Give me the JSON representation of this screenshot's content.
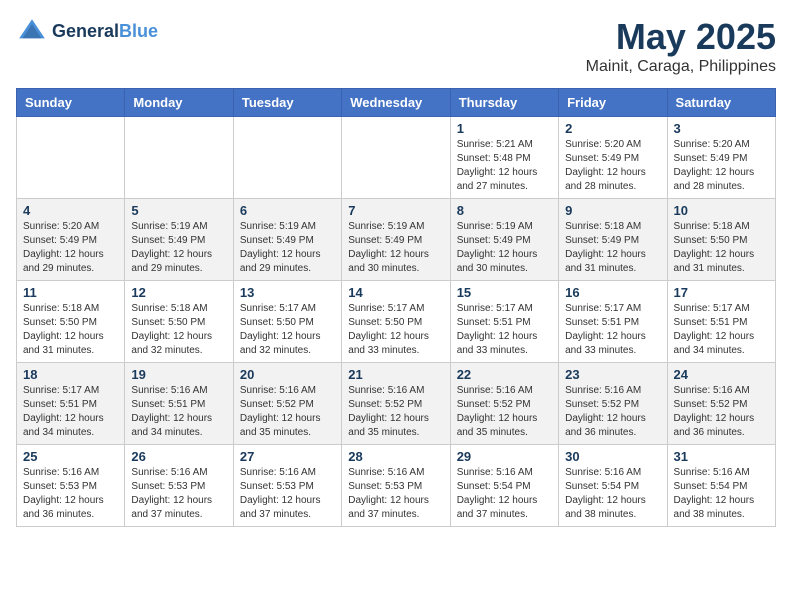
{
  "header": {
    "logo_line1": "General",
    "logo_line2": "Blue",
    "title": "May 2025",
    "subtitle": "Mainit, Caraga, Philippines"
  },
  "weekdays": [
    "Sunday",
    "Monday",
    "Tuesday",
    "Wednesday",
    "Thursday",
    "Friday",
    "Saturday"
  ],
  "weeks": [
    [
      {
        "day": "",
        "info": ""
      },
      {
        "day": "",
        "info": ""
      },
      {
        "day": "",
        "info": ""
      },
      {
        "day": "",
        "info": ""
      },
      {
        "day": "1",
        "info": "Sunrise: 5:21 AM\nSunset: 5:48 PM\nDaylight: 12 hours\nand 27 minutes."
      },
      {
        "day": "2",
        "info": "Sunrise: 5:20 AM\nSunset: 5:49 PM\nDaylight: 12 hours\nand 28 minutes."
      },
      {
        "day": "3",
        "info": "Sunrise: 5:20 AM\nSunset: 5:49 PM\nDaylight: 12 hours\nand 28 minutes."
      }
    ],
    [
      {
        "day": "4",
        "info": "Sunrise: 5:20 AM\nSunset: 5:49 PM\nDaylight: 12 hours\nand 29 minutes."
      },
      {
        "day": "5",
        "info": "Sunrise: 5:19 AM\nSunset: 5:49 PM\nDaylight: 12 hours\nand 29 minutes."
      },
      {
        "day": "6",
        "info": "Sunrise: 5:19 AM\nSunset: 5:49 PM\nDaylight: 12 hours\nand 29 minutes."
      },
      {
        "day": "7",
        "info": "Sunrise: 5:19 AM\nSunset: 5:49 PM\nDaylight: 12 hours\nand 30 minutes."
      },
      {
        "day": "8",
        "info": "Sunrise: 5:19 AM\nSunset: 5:49 PM\nDaylight: 12 hours\nand 30 minutes."
      },
      {
        "day": "9",
        "info": "Sunrise: 5:18 AM\nSunset: 5:49 PM\nDaylight: 12 hours\nand 31 minutes."
      },
      {
        "day": "10",
        "info": "Sunrise: 5:18 AM\nSunset: 5:50 PM\nDaylight: 12 hours\nand 31 minutes."
      }
    ],
    [
      {
        "day": "11",
        "info": "Sunrise: 5:18 AM\nSunset: 5:50 PM\nDaylight: 12 hours\nand 31 minutes."
      },
      {
        "day": "12",
        "info": "Sunrise: 5:18 AM\nSunset: 5:50 PM\nDaylight: 12 hours\nand 32 minutes."
      },
      {
        "day": "13",
        "info": "Sunrise: 5:17 AM\nSunset: 5:50 PM\nDaylight: 12 hours\nand 32 minutes."
      },
      {
        "day": "14",
        "info": "Sunrise: 5:17 AM\nSunset: 5:50 PM\nDaylight: 12 hours\nand 33 minutes."
      },
      {
        "day": "15",
        "info": "Sunrise: 5:17 AM\nSunset: 5:51 PM\nDaylight: 12 hours\nand 33 minutes."
      },
      {
        "day": "16",
        "info": "Sunrise: 5:17 AM\nSunset: 5:51 PM\nDaylight: 12 hours\nand 33 minutes."
      },
      {
        "day": "17",
        "info": "Sunrise: 5:17 AM\nSunset: 5:51 PM\nDaylight: 12 hours\nand 34 minutes."
      }
    ],
    [
      {
        "day": "18",
        "info": "Sunrise: 5:17 AM\nSunset: 5:51 PM\nDaylight: 12 hours\nand 34 minutes."
      },
      {
        "day": "19",
        "info": "Sunrise: 5:16 AM\nSunset: 5:51 PM\nDaylight: 12 hours\nand 34 minutes."
      },
      {
        "day": "20",
        "info": "Sunrise: 5:16 AM\nSunset: 5:52 PM\nDaylight: 12 hours\nand 35 minutes."
      },
      {
        "day": "21",
        "info": "Sunrise: 5:16 AM\nSunset: 5:52 PM\nDaylight: 12 hours\nand 35 minutes."
      },
      {
        "day": "22",
        "info": "Sunrise: 5:16 AM\nSunset: 5:52 PM\nDaylight: 12 hours\nand 35 minutes."
      },
      {
        "day": "23",
        "info": "Sunrise: 5:16 AM\nSunset: 5:52 PM\nDaylight: 12 hours\nand 36 minutes."
      },
      {
        "day": "24",
        "info": "Sunrise: 5:16 AM\nSunset: 5:52 PM\nDaylight: 12 hours\nand 36 minutes."
      }
    ],
    [
      {
        "day": "25",
        "info": "Sunrise: 5:16 AM\nSunset: 5:53 PM\nDaylight: 12 hours\nand 36 minutes."
      },
      {
        "day": "26",
        "info": "Sunrise: 5:16 AM\nSunset: 5:53 PM\nDaylight: 12 hours\nand 37 minutes."
      },
      {
        "day": "27",
        "info": "Sunrise: 5:16 AM\nSunset: 5:53 PM\nDaylight: 12 hours\nand 37 minutes."
      },
      {
        "day": "28",
        "info": "Sunrise: 5:16 AM\nSunset: 5:53 PM\nDaylight: 12 hours\nand 37 minutes."
      },
      {
        "day": "29",
        "info": "Sunrise: 5:16 AM\nSunset: 5:54 PM\nDaylight: 12 hours\nand 37 minutes."
      },
      {
        "day": "30",
        "info": "Sunrise: 5:16 AM\nSunset: 5:54 PM\nDaylight: 12 hours\nand 38 minutes."
      },
      {
        "day": "31",
        "info": "Sunrise: 5:16 AM\nSunset: 5:54 PM\nDaylight: 12 hours\nand 38 minutes."
      }
    ]
  ]
}
